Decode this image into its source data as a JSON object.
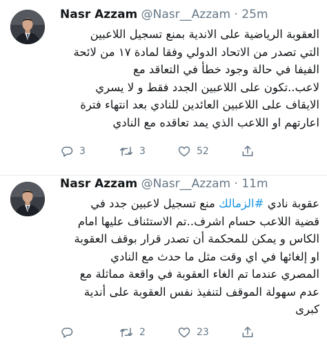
{
  "tweets": [
    {
      "author_name": "Nasr Azzam",
      "handle": "@Nasr__Azzam",
      "separator": "·",
      "time": "25m",
      "lines": [
        "العقوبة الرياضية على الاندية بمنع تسجيل اللاعبين",
        "التي تصدر من الاتحاد الدولي وفقا لمادة ١٧ من لائحة",
        "الفيفا في حالة وجود خطأ في التعاقد مع",
        "لاعب..تكون على اللاعبين الجدد فقط و لا يسري",
        "الايقاف على اللاعبين العائدين للنادي بعد انتهاء فترة",
        "اعارتهم او اللاعب الذي يمد تعاقده مع النادي"
      ],
      "actions": {
        "replies": "3",
        "retweets": "3",
        "likes": "52"
      }
    },
    {
      "author_name": "Nasr Azzam",
      "handle": "@Nasr__Azzam",
      "separator": "·",
      "time": "11m",
      "line1_before": "عقوبة نادي ",
      "hashtag": "#الزمالك",
      "line1_after": " منع تسجيل لاعبين جدد في",
      "lines": [
        "قضية اللاعب حسام اشرف..تم الاستئناف عليها امام",
        "الكاس و يمكن للمحكمة أن تصدر قرار بوقف العقوبة",
        "او إلغائها في اي وقت مثل ما حدث مع النادي",
        "المصري عندما تم الغاء العقوبة في واقعة مماثلة مع",
        "عدم سهولة الموقف لتنفيذ نفس العقوبة على أندية",
        "كبرى"
      ],
      "actions": {
        "replies": "",
        "retweets": "2",
        "likes": "23"
      }
    }
  ],
  "colors": {
    "text": "#14171a",
    "secondary": "#657786",
    "link": "#1b95e0",
    "divider": "#e6ecf0"
  },
  "icons": [
    "reply-icon",
    "retweet-icon",
    "like-icon",
    "share-icon"
  ]
}
